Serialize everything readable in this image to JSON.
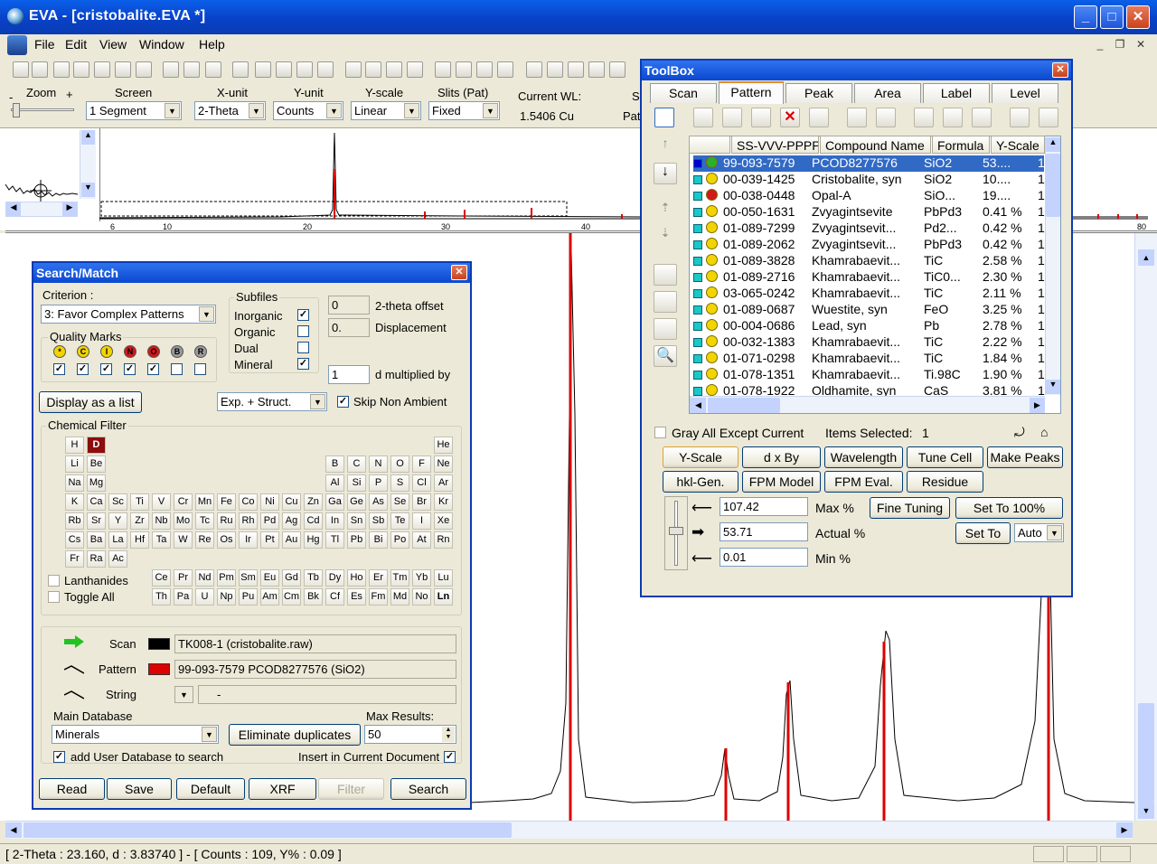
{
  "app": {
    "title": "EVA - [cristobalite.EVA *]"
  },
  "menu": [
    "File",
    "Edit",
    "View",
    "Window",
    "Help"
  ],
  "toolbar_icons": [
    "new-document-icon",
    "open-file-icon",
    "save-icon",
    "print-icon",
    "print-preview-icon",
    "undo-icon",
    "redo-icon",
    "delete-icon",
    "copy-view-icon",
    "zoom-icon",
    "help-icon",
    "pattern-icon",
    "peak-search-icon"
  ],
  "options": {
    "zoom_label": "Zoom",
    "zoom_minus": "-",
    "zoom_plus": "+",
    "screen_label": "Screen",
    "screen_value": "1 Segment",
    "xunit_label": "X-unit",
    "xunit_value": "2-Theta",
    "yunit_label": "Y-unit",
    "yunit_value": "Counts",
    "yscale_label": "Y-scale",
    "yscale_value": "Linear",
    "slits_label": "Slits (Pat)",
    "slits_value": "Fixed",
    "wl_label": "Current WL:",
    "wl_value": "1.5406 Cu",
    "cut_label_1": "S",
    "cut_label_2": "Pat"
  },
  "overview": {
    "ticks": [
      "6",
      "10",
      "20",
      "30",
      "40",
      "80"
    ]
  },
  "status": "[ 2-Theta : 23.160, d : 3.83740 ] - [ Counts : 109, Y% : 0.09 ]",
  "search": {
    "title": "Search/Match",
    "criterion_label": "Criterion :",
    "criterion_value": "3: Favor Complex Patterns",
    "subfiles_label": "Subfiles",
    "subfiles": [
      {
        "label": "Inorganic",
        "checked": true
      },
      {
        "label": "Organic",
        "checked": false
      },
      {
        "label": "Dual",
        "checked": false
      },
      {
        "label": "Mineral",
        "checked": true
      }
    ],
    "offset_value": "0",
    "offset_label": "2-theta offset",
    "displacement_value": "0.",
    "displacement_label": "Displacement",
    "dmult_value": "1",
    "dmult_label": "d multiplied by",
    "quality_label": "Quality Marks",
    "quality_marks": [
      {
        "sym": "*",
        "color": "#f2d500",
        "checked": true
      },
      {
        "sym": "C",
        "color": "#f2d500",
        "checked": true
      },
      {
        "sym": "I",
        "color": "#f2d500",
        "checked": true
      },
      {
        "sym": "N",
        "color": "#d21818",
        "checked": true
      },
      {
        "sym": "O",
        "color": "#d21818",
        "checked": true
      },
      {
        "sym": "B",
        "color": "#9a9a9a",
        "checked": false
      },
      {
        "sym": "R",
        "color": "#9a9a9a",
        "checked": false
      }
    ],
    "display_list_label": "Display as a list",
    "exp_value": "Exp. + Struct.",
    "skip_label": "Skip Non Ambient",
    "chem_label": "Chemical Filter",
    "elements": [
      {
        "s": "H",
        "c": 0,
        "r": 0
      },
      {
        "s": "D",
        "c": 1,
        "r": 0,
        "sel": true
      },
      {
        "s": "He",
        "c": 17,
        "r": 0
      },
      {
        "s": "Li",
        "c": 0,
        "r": 1
      },
      {
        "s": "Be",
        "c": 1,
        "r": 1
      },
      {
        "s": "B",
        "c": 12,
        "r": 1
      },
      {
        "s": "C",
        "c": 13,
        "r": 1
      },
      {
        "s": "N",
        "c": 14,
        "r": 1
      },
      {
        "s": "O",
        "c": 15,
        "r": 1
      },
      {
        "s": "F",
        "c": 16,
        "r": 1
      },
      {
        "s": "Ne",
        "c": 17,
        "r": 1
      },
      {
        "s": "Na",
        "c": 0,
        "r": 2
      },
      {
        "s": "Mg",
        "c": 1,
        "r": 2
      },
      {
        "s": "Al",
        "c": 12,
        "r": 2
      },
      {
        "s": "Si",
        "c": 13,
        "r": 2
      },
      {
        "s": "P",
        "c": 14,
        "r": 2
      },
      {
        "s": "S",
        "c": 15,
        "r": 2
      },
      {
        "s": "Cl",
        "c": 16,
        "r": 2
      },
      {
        "s": "Ar",
        "c": 17,
        "r": 2
      },
      {
        "s": "K",
        "c": 0,
        "r": 3
      },
      {
        "s": "Ca",
        "c": 1,
        "r": 3
      },
      {
        "s": "Sc",
        "c": 2,
        "r": 3
      },
      {
        "s": "Ti",
        "c": 3,
        "r": 3
      },
      {
        "s": "V",
        "c": 4,
        "r": 3
      },
      {
        "s": "Cr",
        "c": 5,
        "r": 3
      },
      {
        "s": "Mn",
        "c": 6,
        "r": 3
      },
      {
        "s": "Fe",
        "c": 7,
        "r": 3
      },
      {
        "s": "Co",
        "c": 8,
        "r": 3
      },
      {
        "s": "Ni",
        "c": 9,
        "r": 3
      },
      {
        "s": "Cu",
        "c": 10,
        "r": 3
      },
      {
        "s": "Zn",
        "c": 11,
        "r": 3
      },
      {
        "s": "Ga",
        "c": 12,
        "r": 3
      },
      {
        "s": "Ge",
        "c": 13,
        "r": 3
      },
      {
        "s": "As",
        "c": 14,
        "r": 3
      },
      {
        "s": "Se",
        "c": 15,
        "r": 3
      },
      {
        "s": "Br",
        "c": 16,
        "r": 3
      },
      {
        "s": "Kr",
        "c": 17,
        "r": 3
      },
      {
        "s": "Rb",
        "c": 0,
        "r": 4
      },
      {
        "s": "Sr",
        "c": 1,
        "r": 4
      },
      {
        "s": "Y",
        "c": 2,
        "r": 4
      },
      {
        "s": "Zr",
        "c": 3,
        "r": 4
      },
      {
        "s": "Nb",
        "c": 4,
        "r": 4
      },
      {
        "s": "Mo",
        "c": 5,
        "r": 4
      },
      {
        "s": "Tc",
        "c": 6,
        "r": 4
      },
      {
        "s": "Ru",
        "c": 7,
        "r": 4
      },
      {
        "s": "Rh",
        "c": 8,
        "r": 4
      },
      {
        "s": "Pd",
        "c": 9,
        "r": 4
      },
      {
        "s": "Ag",
        "c": 10,
        "r": 4
      },
      {
        "s": "Cd",
        "c": 11,
        "r": 4
      },
      {
        "s": "In",
        "c": 12,
        "r": 4
      },
      {
        "s": "Sn",
        "c": 13,
        "r": 4
      },
      {
        "s": "Sb",
        "c": 14,
        "r": 4
      },
      {
        "s": "Te",
        "c": 15,
        "r": 4
      },
      {
        "s": "I",
        "c": 16,
        "r": 4
      },
      {
        "s": "Xe",
        "c": 17,
        "r": 4
      },
      {
        "s": "Cs",
        "c": 0,
        "r": 5
      },
      {
        "s": "Ba",
        "c": 1,
        "r": 5
      },
      {
        "s": "La",
        "c": 2,
        "r": 5
      },
      {
        "s": "Hf",
        "c": 3,
        "r": 5
      },
      {
        "s": "Ta",
        "c": 4,
        "r": 5
      },
      {
        "s": "W",
        "c": 5,
        "r": 5
      },
      {
        "s": "Re",
        "c": 6,
        "r": 5
      },
      {
        "s": "Os",
        "c": 7,
        "r": 5
      },
      {
        "s": "Ir",
        "c": 8,
        "r": 5
      },
      {
        "s": "Pt",
        "c": 9,
        "r": 5
      },
      {
        "s": "Au",
        "c": 10,
        "r": 5
      },
      {
        "s": "Hg",
        "c": 11,
        "r": 5
      },
      {
        "s": "Tl",
        "c": 12,
        "r": 5
      },
      {
        "s": "Pb",
        "c": 13,
        "r": 5
      },
      {
        "s": "Bi",
        "c": 14,
        "r": 5
      },
      {
        "s": "Po",
        "c": 15,
        "r": 5
      },
      {
        "s": "At",
        "c": 16,
        "r": 5
      },
      {
        "s": "Rn",
        "c": 17,
        "r": 5
      },
      {
        "s": "Fr",
        "c": 0,
        "r": 6
      },
      {
        "s": "Ra",
        "c": 1,
        "r": 6
      },
      {
        "s": "Ac",
        "c": 2,
        "r": 6
      }
    ],
    "lanthanides": [
      "Ce",
      "Pr",
      "Nd",
      "Pm",
      "Sm",
      "Eu",
      "Gd",
      "Tb",
      "Dy",
      "Ho",
      "Er",
      "Tm",
      "Yb",
      "Lu"
    ],
    "actinides": [
      "Th",
      "Pa",
      "U",
      "Np",
      "Pu",
      "Am",
      "Cm",
      "Bk",
      "Cf",
      "Es",
      "Fm",
      "Md",
      "No",
      "Ln"
    ],
    "lanthanides_label": "Lanthanides",
    "toggle_label": "Toggle All",
    "scan_label": "Scan",
    "scan_value": "TK008-1 (cristobalite.raw)",
    "scan_color": "#000000",
    "pattern_label": "Pattern",
    "pattern_value": "99-093-7579 PCOD8277576 (SiO2)",
    "pattern_color": "#dd0000",
    "string_label": "String",
    "string_value": "-",
    "maindb_label": "Main Database",
    "maindb_value": "Minerals",
    "elim_label": "Eliminate duplicates",
    "maxres_label": "Max Results:",
    "maxres_value": "50",
    "userdb_label": "add User Database to search",
    "insert_label": "Insert in Current Document",
    "buttons": [
      "Read",
      "Save",
      "Default",
      "XRF",
      "Filter",
      "Search"
    ]
  },
  "toolbox": {
    "title": "ToolBox",
    "tabs": [
      "Scan",
      "Pattern",
      "Peak",
      "Area",
      "Label",
      "Level"
    ],
    "active_tab": "Pattern",
    "columns": [
      "SS-VVV-PPPP",
      "Compound Name",
      "Formula",
      "Y-Scale"
    ],
    "rows": [
      {
        "id": "99-093-7579",
        "name": "PCOD8277576",
        "formula": "SiO2",
        "yscale": "53....",
        "n": "1",
        "mark": "#2bb02b",
        "sel": true
      },
      {
        "id": "00-039-1425",
        "name": "Cristobalite, syn",
        "formula": "SiO2",
        "yscale": "10....",
        "n": "1",
        "mark": "#f2d500"
      },
      {
        "id": "00-038-0448",
        "name": "Opal-A",
        "formula": "SiO...",
        "yscale": "19....",
        "n": "1",
        "mark": "#d21818"
      },
      {
        "id": "00-050-1631",
        "name": "Zvyagintsevite",
        "formula": "PbPd3",
        "yscale": "0.41 %",
        "n": "1",
        "mark": "#f2d500"
      },
      {
        "id": "01-089-7299",
        "name": "Zvyagintsevit...",
        "formula": "Pd2...",
        "yscale": "0.42 %",
        "n": "1",
        "mark": "#f2d500"
      },
      {
        "id": "01-089-2062",
        "name": "Zvyagintsevit...",
        "formula": "PbPd3",
        "yscale": "0.42 %",
        "n": "1",
        "mark": "#f2d500"
      },
      {
        "id": "01-089-3828",
        "name": "Khamrabaevit...",
        "formula": "TiC",
        "yscale": "2.58 %",
        "n": "1",
        "mark": "#f2d500"
      },
      {
        "id": "01-089-2716",
        "name": "Khamrabaevit...",
        "formula": "TiC0...",
        "yscale": "2.30 %",
        "n": "1",
        "mark": "#f2d500"
      },
      {
        "id": "03-065-0242",
        "name": "Khamrabaevit...",
        "formula": "TiC",
        "yscale": "2.11 %",
        "n": "1",
        "mark": "#f2d500"
      },
      {
        "id": "01-089-0687",
        "name": "Wuestite, syn",
        "formula": "FeO",
        "yscale": "3.25 %",
        "n": "1",
        "mark": "#f2d500"
      },
      {
        "id": "00-004-0686",
        "name": "Lead, syn",
        "formula": "Pb",
        "yscale": "2.78 %",
        "n": "1",
        "mark": "#f2d500"
      },
      {
        "id": "00-032-1383",
        "name": "Khamrabaevit...",
        "formula": "TiC",
        "yscale": "2.22 %",
        "n": "1",
        "mark": "#f2d500"
      },
      {
        "id": "01-071-0298",
        "name": "Khamrabaevit...",
        "formula": "TiC",
        "yscale": "1.84 %",
        "n": "1",
        "mark": "#f2d500"
      },
      {
        "id": "01-078-1351",
        "name": "Khamrabaevit...",
        "formula": "Ti.98C",
        "yscale": "1.90 %",
        "n": "1",
        "mark": "#f2d500"
      },
      {
        "id": "01-078-1922",
        "name": "Oldhamite, syn",
        "formula": "CaS",
        "yscale": "3.81 %",
        "n": "1",
        "mark": "#f2d500"
      }
    ],
    "gray_label": "Gray All Except Current",
    "items_label": "Items Selected:",
    "items_value": "1",
    "btn_row1": [
      "Y-Scale",
      "d x By",
      "Wavelength",
      "Tune Cell",
      "Make Peaks"
    ],
    "btn_row2": [
      "hkl-Gen.",
      "FPM Model",
      "FPM Eval.",
      "Residue"
    ],
    "max_value": "107.42",
    "max_label": "Max %",
    "fine_label": "Fine Tuning",
    "set100_label": "Set To 100%",
    "actual_value": "53.71",
    "actual_label": "Actual %",
    "setto_label": "Set To",
    "auto_value": "Auto",
    "min_value": "0.01",
    "min_label": "Min %"
  }
}
